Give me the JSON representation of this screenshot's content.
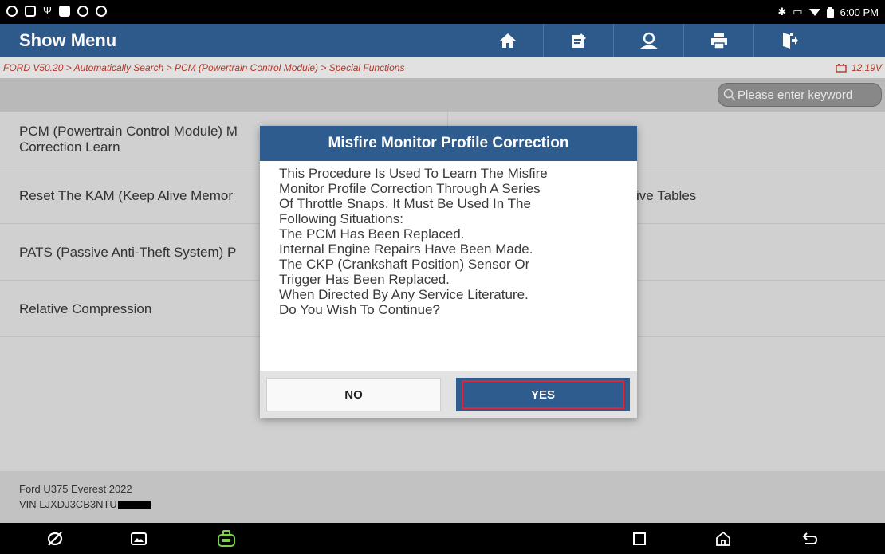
{
  "status_bar": {
    "time": "6:00 PM",
    "icons": [
      "app-icon",
      "image-icon",
      "usb-icon",
      "square-icon",
      "record-icon",
      "settings-icon"
    ],
    "right_icons": [
      "bluetooth-icon",
      "vibrate-icon",
      "wifi-icon",
      "battery-icon"
    ]
  },
  "header": {
    "title": "Show Menu",
    "buttons": [
      "home-icon",
      "edit-icon",
      "user-icon",
      "print-icon",
      "exit-icon"
    ]
  },
  "breadcrumb": {
    "path": "FORD V50.20 > Automatically Search > PCM (Powertrain Control Module) > Special Functions",
    "voltage": "12.19V"
  },
  "search": {
    "placeholder": "Please enter keyword"
  },
  "menu": {
    "rows": [
      {
        "left": "PCM (Powertrain Control Module) Misfire Monitor Profile Correction Learn",
        "right": ""
      },
      {
        "left": "Reset The KAM (Keep Alive Memory) Adaptive Tables",
        "right": "Adaptive Tables"
      },
      {
        "left": "PATS (Passive Anti-Theft System) Parameter Reset",
        "right": ""
      },
      {
        "left": "Relative Compression",
        "right": ""
      }
    ],
    "left_visible": [
      "PCM (Powertrain Control Module) M",
      "Correction Learn",
      "Reset The KAM (Keep Alive Memor",
      "PATS (Passive Anti-Theft System) P",
      "Relative Compression"
    ],
    "right_visible": [
      "ive Tables"
    ]
  },
  "footer": {
    "vehicle": "Ford U375 Everest 2022",
    "vin": "VIN LJXDJ3CB3NTU"
  },
  "dialog": {
    "title": "Misfire Monitor Profile Correction",
    "lines": [
      "This Procedure Is Used To Learn The Misfire",
      "Monitor Profile Correction Through A Series",
      "Of Throttle Snaps. It Must Be Used In The",
      "Following Situations:",
      "The PCM Has Been Replaced.",
      "Internal Engine Repairs Have Been Made.",
      "The CKP (Crankshaft Position) Sensor Or",
      "Trigger Has Been Replaced.",
      "When Directed By Any Service Literature.",
      "Do You Wish To Continue?"
    ],
    "no_label": "NO",
    "yes_label": "YES"
  },
  "nav_bar": {
    "icons": [
      "browser-icon",
      "gallery-icon",
      "vci-icon",
      "recents-icon",
      "home-nav-icon",
      "back-icon"
    ]
  },
  "colors": {
    "header_bg": "#2e5c8e",
    "breadcrumb_text": "#b63a2a",
    "highlight_border": "#d32b3d"
  }
}
